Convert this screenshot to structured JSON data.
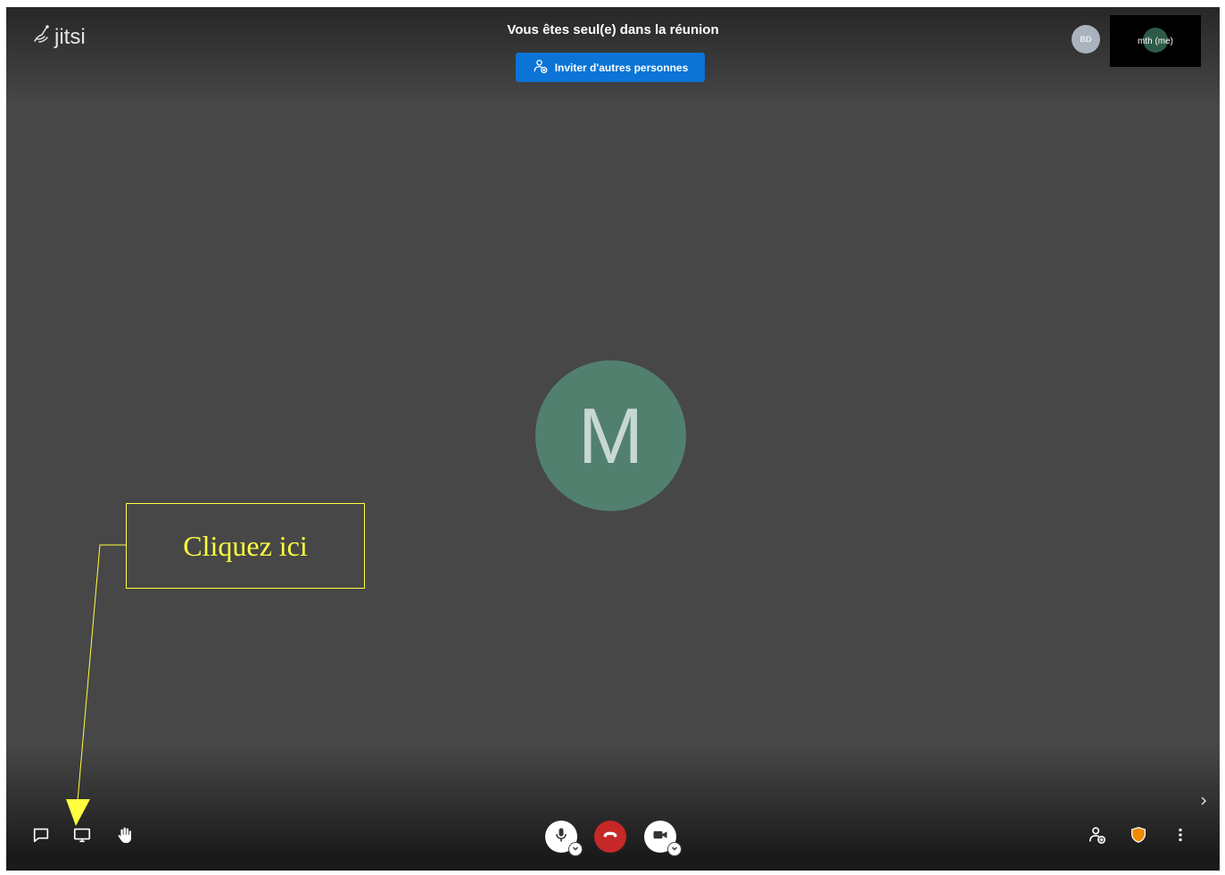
{
  "header": {
    "logo_text": "jitsi",
    "title": "Vous êtes seul(e) dans la réunion",
    "invite_label": "Inviter d'autres personnes"
  },
  "participants": {
    "remote_initials": "BD",
    "self_name": "mth (me)",
    "main_avatar_initial": "M"
  },
  "annotation": {
    "callout_text": "Cliquez ici",
    "color": "#ffff40"
  },
  "toolbar": {
    "left": [
      "chat-icon",
      "screenshare-icon",
      "raise-hand-icon"
    ],
    "center": [
      "microphone-icon",
      "hangup-icon",
      "camera-icon"
    ],
    "right": [
      "invite-user-icon",
      "security-shield-icon",
      "more-vertical-icon"
    ]
  },
  "colors": {
    "background": "#474747",
    "invite_button": "#0b74d6",
    "hangup": "#c62828",
    "avatar": "#52806f",
    "shield": "#ef8a00"
  }
}
